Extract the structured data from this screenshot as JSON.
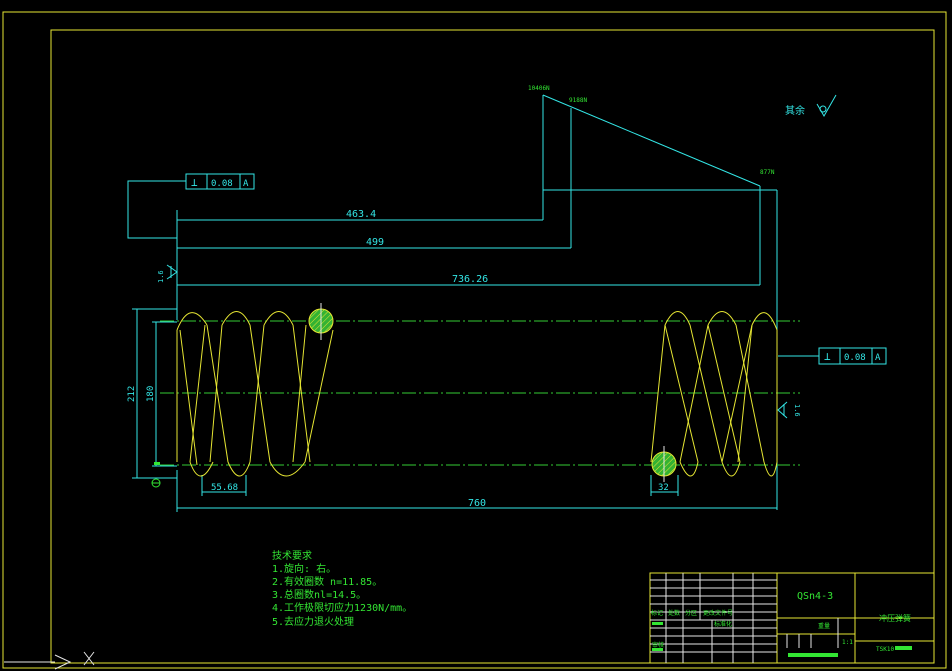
{
  "dimensions": {
    "d1": "463.4",
    "d2": "499",
    "d3": "736.26",
    "overall_length": "760",
    "outer_height": "212",
    "inner_height": "180",
    "pitch": "55.68",
    "wire_diameter": "32"
  },
  "loads": {
    "f1": "10406N",
    "f2": "9188N",
    "f3": "877N"
  },
  "tolerance": {
    "symbol": "⊥",
    "value": "0.08",
    "datum": "A"
  },
  "roughness": {
    "value": "1.6",
    "remaining_label": "其余"
  },
  "tech_requirements": {
    "heading": "技术要求",
    "items": [
      "1.旋向: 右。",
      "2.有效圈数 n=11.85。",
      "3.总圈数nl=14.5。",
      "4.工作极限切应力1230N/mm。",
      "5.去应力退火处理"
    ]
  },
  "title_block": {
    "material": "QSn4-3",
    "part_name": "冲压弹簧",
    "scale": "1:1",
    "hdr_mark": "标记",
    "hdr_count": "处数",
    "hdr_zone": "分区",
    "hdr_doc": "更改文件号",
    "hdr_std": "标准化",
    "hdr_design": "设计",
    "hdr_check": "审核",
    "weight_label": "重量",
    "drawing_no": "TSK10"
  },
  "colors": {
    "dimension": "#33e6e6",
    "outline": "#e6e633",
    "text": "#33e633",
    "border": "#e6e633",
    "centerline": "#33cc33"
  }
}
